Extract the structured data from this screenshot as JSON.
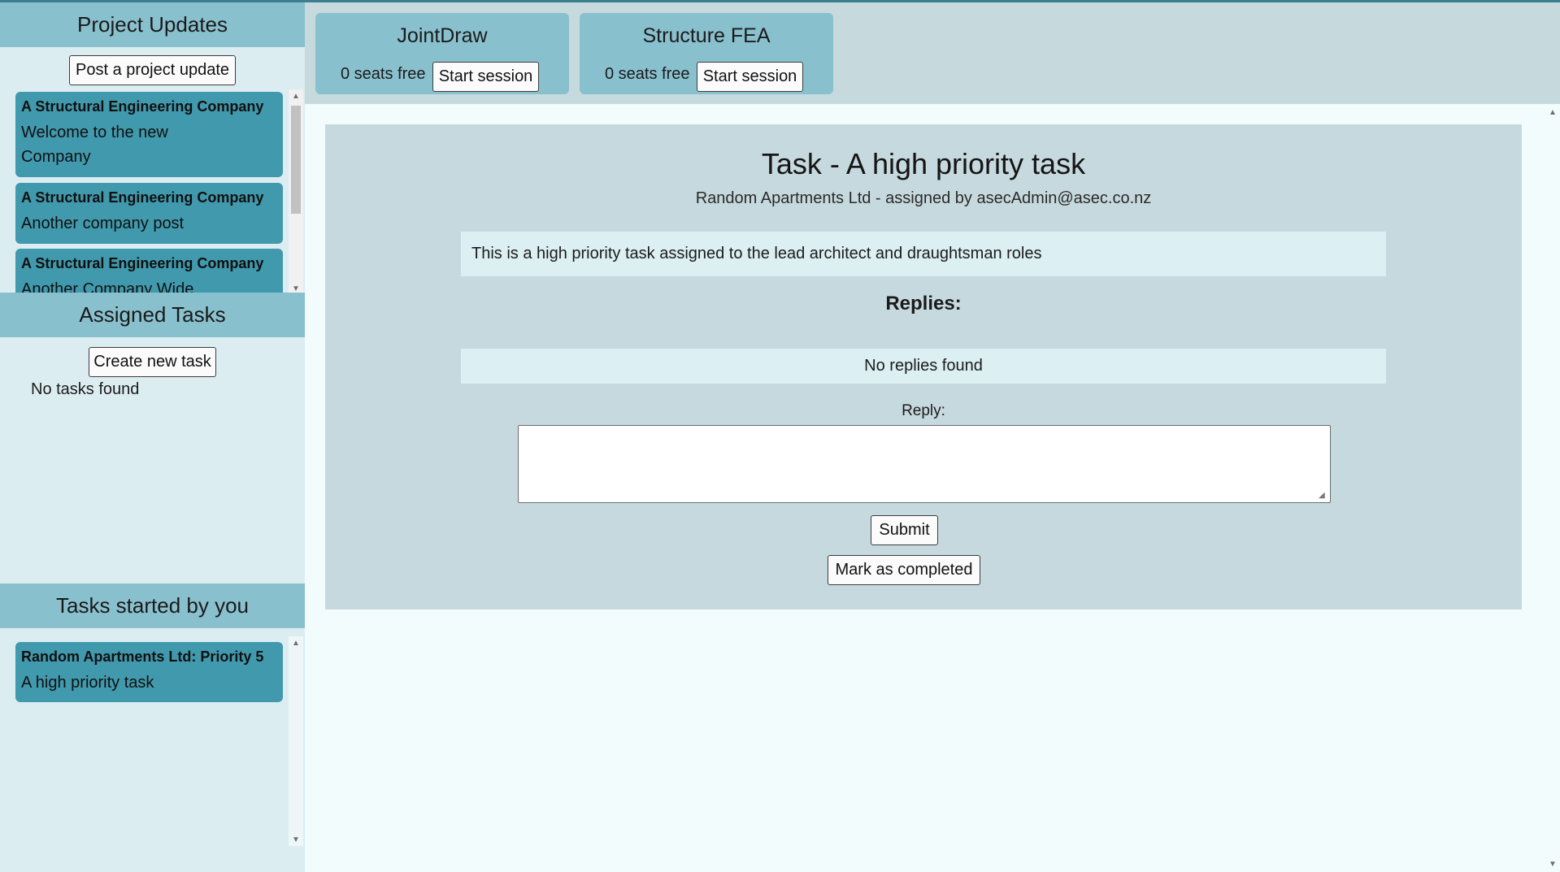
{
  "sidebar": {
    "project_updates": {
      "title": "Project Updates",
      "post_button": "Post a project update",
      "items": [
        {
          "company": "A Structural Engineering Company",
          "text": "Welcome to the new Company"
        },
        {
          "company": "A Structural Engineering Company",
          "text": "Another company post"
        },
        {
          "company": "A Structural Engineering Company",
          "text": "Another Company Wide"
        }
      ]
    },
    "assigned_tasks": {
      "title": "Assigned Tasks",
      "create_button": "Create new task",
      "empty_text": "No tasks found"
    },
    "tasks_started": {
      "title": "Tasks started by you",
      "items": [
        {
          "heading": "Random Apartments Ltd: Priority 5",
          "text": "A high priority task"
        }
      ]
    }
  },
  "licenses": [
    {
      "name": "JointDraw",
      "seats": "0 seats free",
      "button": "Start session"
    },
    {
      "name": "Structure FEA",
      "seats": "0 seats free",
      "button": "Start session"
    }
  ],
  "task": {
    "title": "Task - A high priority task",
    "subtitle": "Random Apartments Ltd - assigned by asecAdmin@asec.co.nz",
    "description": "This is a high priority task assigned to the lead architect and draughtsman roles",
    "replies_heading": "Replies:",
    "no_replies": "No replies found",
    "reply_label": "Reply:",
    "reply_value": "",
    "submit_button": "Submit",
    "complete_button": "Mark as completed"
  },
  "icons": {
    "scroll_up": "▲",
    "scroll_down": "▼",
    "resize_grip": "◢"
  },
  "colors": {
    "header_teal": "#89c0ce",
    "card_teal": "#4199ad",
    "sidebar_bg": "#dcedf2",
    "panel_bg": "#c6d9de",
    "accent_line": "#3b7f8f"
  }
}
